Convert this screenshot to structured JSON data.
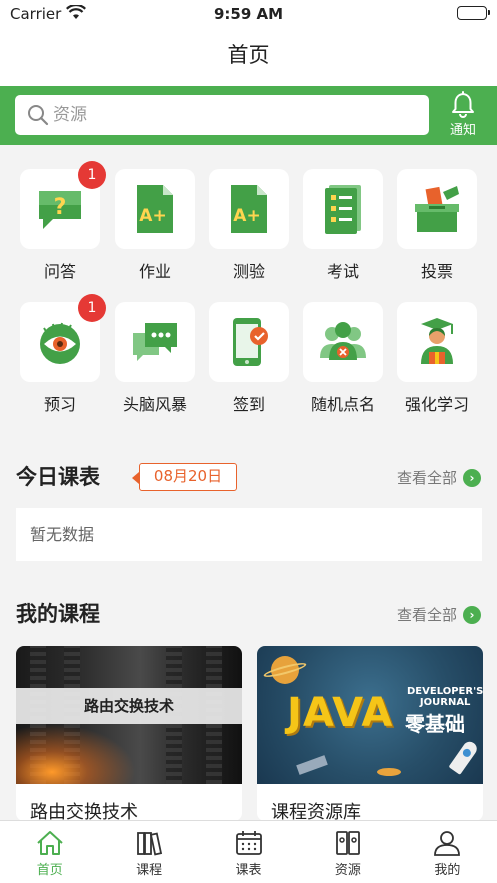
{
  "status": {
    "carrier": "Carrier",
    "time": "9:59 AM"
  },
  "nav": {
    "title": "首页"
  },
  "search": {
    "placeholder": "资源",
    "notify_label": "通知"
  },
  "features": [
    {
      "label": "问答",
      "icon": "question-chat-icon",
      "badge": "1"
    },
    {
      "label": "作业",
      "icon": "homework-doc-icon"
    },
    {
      "label": "测验",
      "icon": "quiz-doc-icon"
    },
    {
      "label": "考试",
      "icon": "exam-checklist-icon"
    },
    {
      "label": "投票",
      "icon": "ballot-box-icon"
    },
    {
      "label": "预习",
      "icon": "eye-icon",
      "badge": "1"
    },
    {
      "label": "头脑风暴",
      "icon": "brainstorm-chat-icon"
    },
    {
      "label": "签到",
      "icon": "phone-checkin-icon"
    },
    {
      "label": "随机点名",
      "icon": "random-rollcall-icon"
    },
    {
      "label": "强化学习",
      "icon": "graduate-icon"
    }
  ],
  "today": {
    "title": "今日课表",
    "date": "08月20日",
    "see_all": "查看全部",
    "empty": "暂无数据"
  },
  "courses": {
    "title": "我的课程",
    "see_all": "查看全部",
    "items": [
      {
        "title": "路由交换技术",
        "banner": "路由交换技术"
      },
      {
        "title": "课程资源库",
        "banner_main": "JAVA",
        "banner_sub1": "DEVELOPER'S",
        "banner_sub2": "JOURNAL",
        "banner_zh": "零基础"
      }
    ]
  },
  "tabs": [
    {
      "label": "首页",
      "icon": "home-icon",
      "active": true
    },
    {
      "label": "课程",
      "icon": "books-icon"
    },
    {
      "label": "课表",
      "icon": "calendar-icon"
    },
    {
      "label": "资源",
      "icon": "resources-icon"
    },
    {
      "label": "我的",
      "icon": "user-icon"
    }
  ],
  "colors": {
    "primary": "#4caf50",
    "badge": "#e53935",
    "date_tag": "#e8622c"
  }
}
